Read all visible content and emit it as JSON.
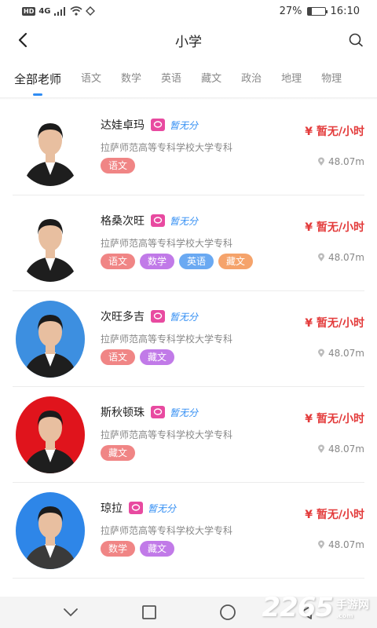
{
  "status_bar": {
    "left_badge": "HD",
    "network": "4G",
    "battery": "27%",
    "battery_level": 0.27,
    "time": "16:10"
  },
  "header": {
    "title": "小学"
  },
  "tabs": [
    {
      "label": "全部老师",
      "active": true
    },
    {
      "label": "语文",
      "active": false
    },
    {
      "label": "数学",
      "active": false
    },
    {
      "label": "英语",
      "active": false
    },
    {
      "label": "藏文",
      "active": false
    },
    {
      "label": "政治",
      "active": false
    },
    {
      "label": "地理",
      "active": false
    },
    {
      "label": "物理",
      "active": false
    }
  ],
  "teachers": [
    {
      "name": "达娃卓玛",
      "rating": "暂无分",
      "school": "拉萨师范高等专科学校大学专科",
      "price": "¥ 暂无/小时",
      "distance": "48.07m",
      "tags": [
        {
          "label": "语文",
          "cls": "t-yuwen"
        }
      ],
      "avatar_bg": "#ffffff"
    },
    {
      "name": "格桑次旺",
      "rating": "暂无分",
      "school": "拉萨师范高等专科学校大学专科",
      "price": "¥ 暂无/小时",
      "distance": "48.07m",
      "tags": [
        {
          "label": "语文",
          "cls": "t-yuwen"
        },
        {
          "label": "数学",
          "cls": "t-shuxue"
        },
        {
          "label": "英语",
          "cls": "t-yingyu"
        },
        {
          "label": "藏文",
          "cls": "t-zangwen"
        }
      ],
      "avatar_bg": "#ffffff"
    },
    {
      "name": "次旺多吉",
      "rating": "暂无分",
      "school": "拉萨师范高等专科学校大学专科",
      "price": "¥ 暂无/小时",
      "distance": "48.07m",
      "tags": [
        {
          "label": "语文",
          "cls": "t-yuwen"
        },
        {
          "label": "藏文",
          "cls": "t-shuxue"
        }
      ],
      "avatar_bg": "#3d8fe0"
    },
    {
      "name": "斯秋顿珠",
      "rating": "暂无分",
      "school": "拉萨师范高等专科学校大学专科",
      "price": "¥ 暂无/小时",
      "distance": "48.07m",
      "tags": [
        {
          "label": "藏文",
          "cls": "t-yuwen"
        }
      ],
      "avatar_bg": "#e0141c"
    },
    {
      "name": "琼拉",
      "rating": "暂无分",
      "school": "拉萨师范高等专科学校大学专科",
      "price": "¥ 暂无/小时",
      "distance": "48.07m",
      "tags": [
        {
          "label": "数学",
          "cls": "t-yuwen"
        },
        {
          "label": "藏文",
          "cls": "t-shuxue"
        }
      ],
      "avatar_bg": "#2e86e8"
    }
  ],
  "watermark": {
    "number": "2265",
    "text": "手游网",
    "sub": ".com"
  },
  "colors": {
    "accent": "#2f8cf3",
    "price": "#e33b3b",
    "rating_icon": "#e84aa0"
  }
}
